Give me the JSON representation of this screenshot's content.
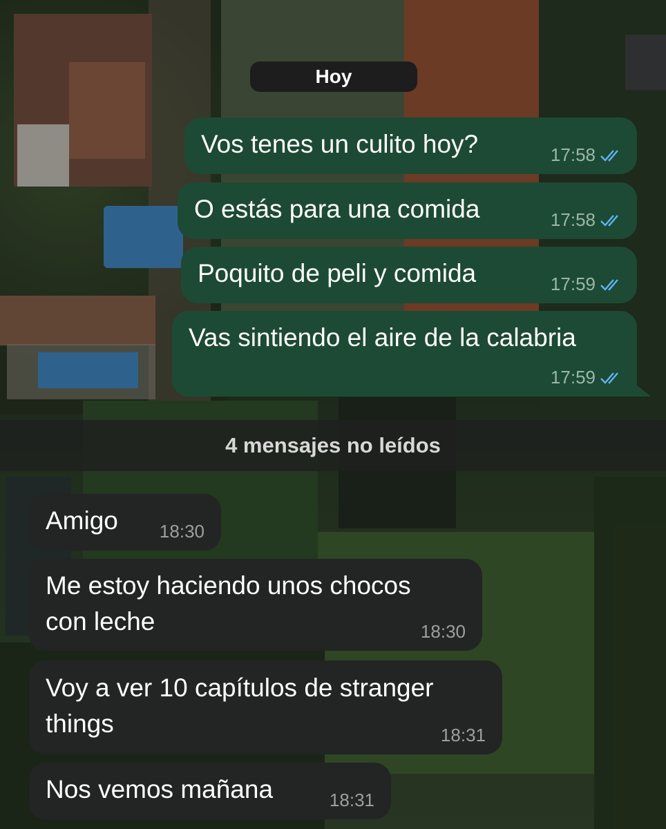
{
  "date_chip": "Hoy",
  "outgoing": [
    {
      "text": "Vos tenes un culito hoy?",
      "time": "17:58"
    },
    {
      "text": "O estás para una comida",
      "time": "17:58"
    },
    {
      "text": "Poquito de peli y comida",
      "time": "17:59"
    },
    {
      "text": "Vas sintiendo el aire de la calabria",
      "time": "17:59"
    }
  ],
  "unread_banner": "4 mensajes no leídos",
  "incoming": [
    {
      "lines": [
        "Amigo"
      ],
      "time": "18:30"
    },
    {
      "lines": [
        "Me estoy haciendo unos chocos",
        "con leche"
      ],
      "time": "18:30"
    },
    {
      "lines": [
        "Voy a ver 10 capítulos de stranger",
        "things"
      ],
      "time": "18:31"
    },
    {
      "lines": [
        "Nos vemos mañana"
      ],
      "time": "18:31"
    }
  ],
  "icons": {
    "read_receipt": "double-check-icon"
  },
  "colors": {
    "outgoing_bubble": "#1d4a34",
    "incoming_bubble": "#232524",
    "read_tick": "#5eb5f7"
  }
}
